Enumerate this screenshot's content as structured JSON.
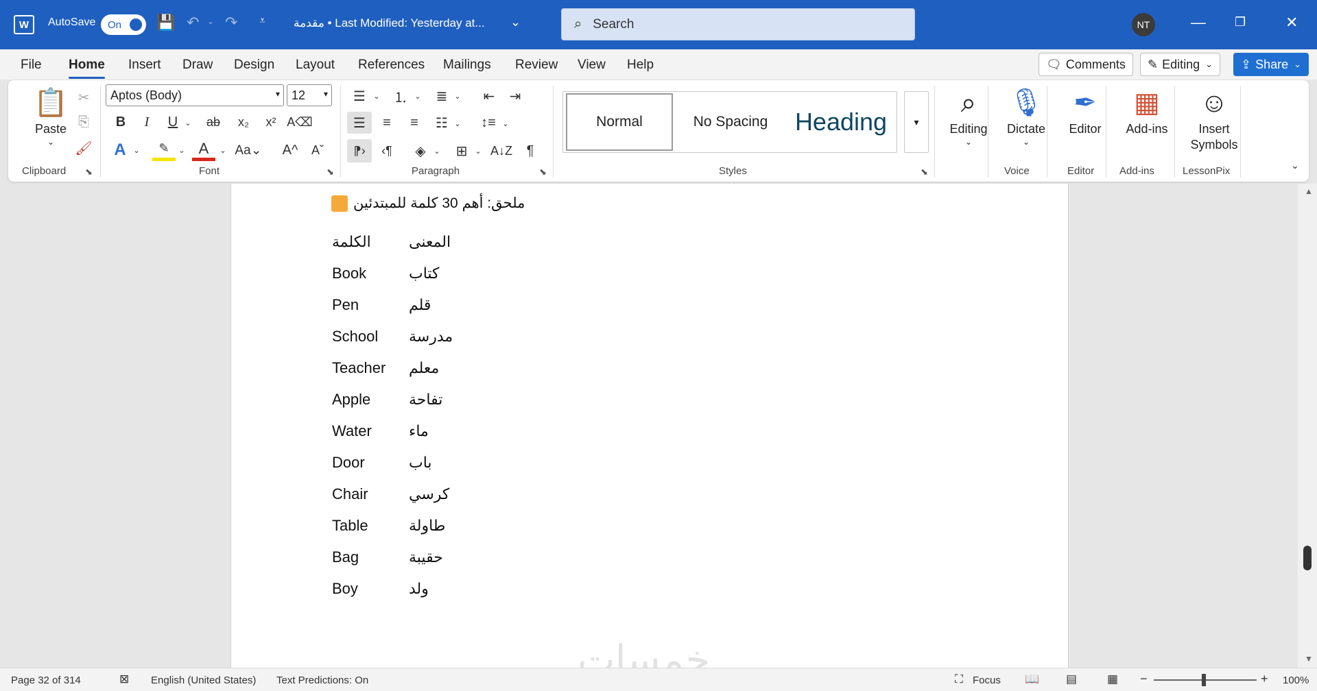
{
  "titlebar": {
    "app_letter": "W",
    "autosave_label": "AutoSave",
    "autosave_state": "On",
    "doc_title": "مقدمة • Last Modified: Yesterday at...",
    "search_placeholder": "Search",
    "user_initials": "NT"
  },
  "menu": {
    "tabs": [
      "File",
      "Home",
      "Insert",
      "Draw",
      "Design",
      "Layout",
      "References",
      "Mailings",
      "Review",
      "View",
      "Help"
    ],
    "active_tab": "Home",
    "comments_label": "Comments",
    "editing_label": "Editing",
    "share_label": "Share"
  },
  "ribbon": {
    "clipboard": {
      "paste_label": "Paste",
      "group_label": "Clipboard"
    },
    "font": {
      "font_name": "Aptos (Body)",
      "font_size": "12",
      "group_label": "Font"
    },
    "paragraph": {
      "group_label": "Paragraph"
    },
    "styles": {
      "normal": "Normal",
      "no_spacing": "No Spacing",
      "heading": "Heading",
      "group_label": "Styles"
    },
    "editing": {
      "label": "Editing"
    },
    "voice": {
      "dictate_label": "Dictate",
      "group_label": "Voice"
    },
    "editor": {
      "label": "Editor",
      "group_label": "Editor"
    },
    "addins": {
      "label": "Add-ins",
      "group_label": "Add-ins"
    },
    "lessonpix": {
      "label_line1": "Insert",
      "label_line2": "Symbols",
      "group_label": "LessonPix"
    }
  },
  "document": {
    "appendix_heading": "ملحق: أهم 30 كلمة للمبتدئين",
    "header_row": {
      "en": "الكلمة",
      "ar": "المعنى"
    },
    "vocab": [
      {
        "en": "Book",
        "ar": "كتاب"
      },
      {
        "en": "Pen",
        "ar": "قلم"
      },
      {
        "en": "School",
        "ar": "مدرسة"
      },
      {
        "en": "Teacher",
        "ar": "معلم"
      },
      {
        "en": "Apple",
        "ar": "تفاحة"
      },
      {
        "en": "Water",
        "ar": "ماء"
      },
      {
        "en": "Door",
        "ar": "باب"
      },
      {
        "en": "Chair",
        "ar": "كرسي"
      },
      {
        "en": "Table",
        "ar": "طاولة"
      },
      {
        "en": "Bag",
        "ar": "حقيبة"
      },
      {
        "en": "Boy",
        "ar": "ولد"
      }
    ],
    "watermark": "خمسات"
  },
  "status": {
    "page": "Page 32 of 314",
    "language": "English (United States)",
    "predictions": "Text Predictions: On",
    "focus": "Focus",
    "zoom": "100%"
  },
  "colors": {
    "titlebar": "#1f5fbf",
    "accent": "#1f6fd1",
    "heading_style": "#0f4761"
  }
}
